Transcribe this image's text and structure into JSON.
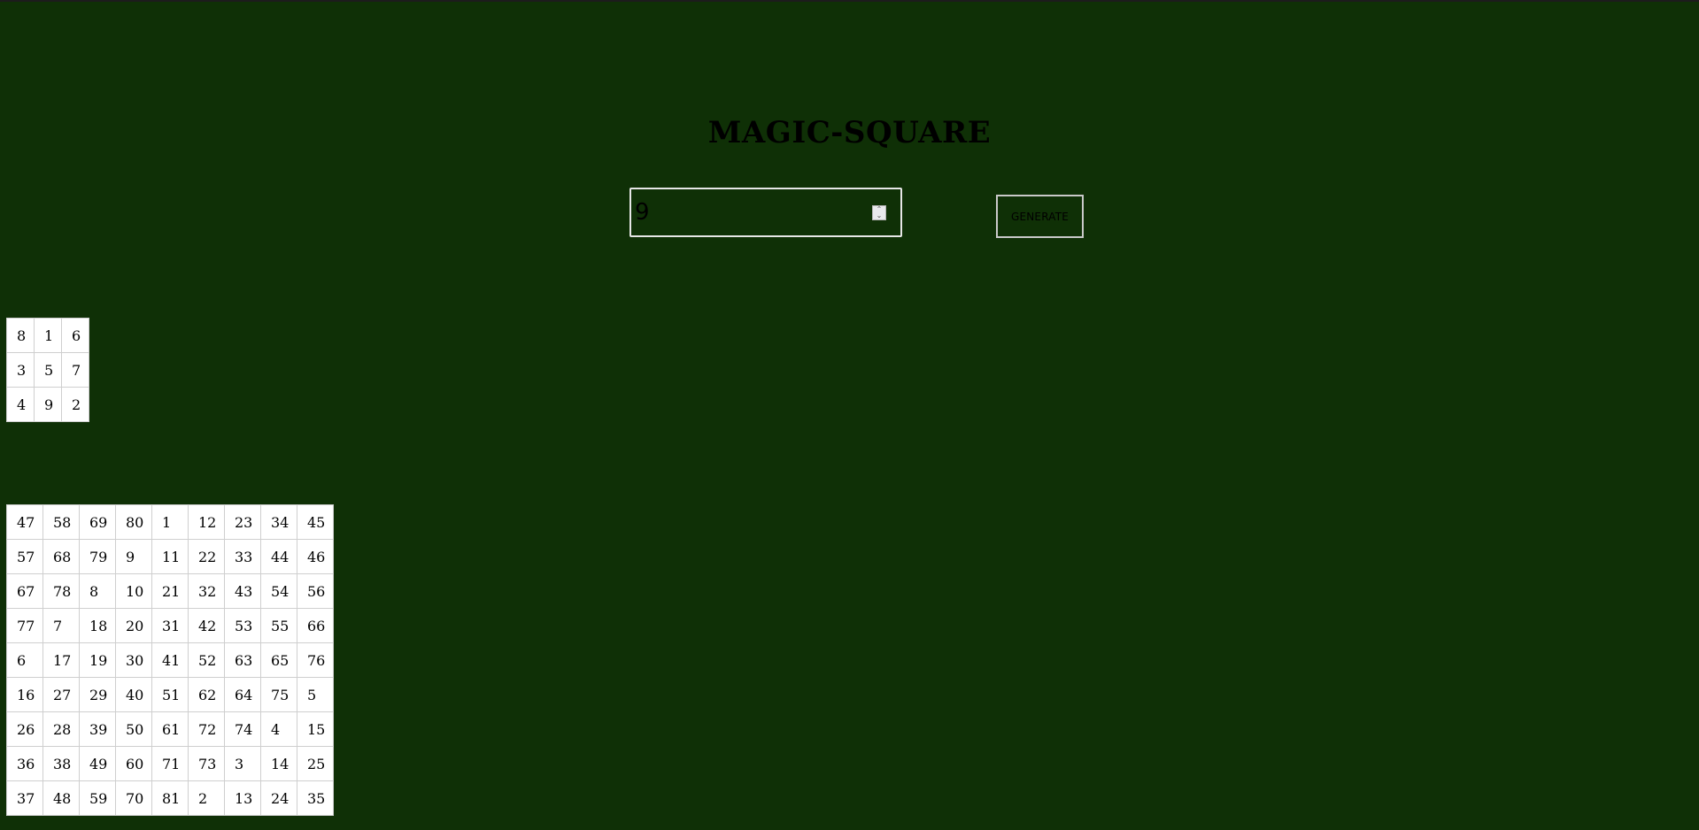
{
  "title": "MAGIC-SQUARE",
  "input": {
    "value": "9"
  },
  "generate_label": "GENERATE",
  "squares": [
    {
      "rows": [
        [
          "8",
          "1",
          "6"
        ],
        [
          "3",
          "5",
          "7"
        ],
        [
          "4",
          "9",
          "2"
        ]
      ]
    },
    {
      "rows": [
        [
          "47",
          "58",
          "69",
          "80",
          "1",
          "12",
          "23",
          "34",
          "45"
        ],
        [
          "57",
          "68",
          "79",
          "9",
          "11",
          "22",
          "33",
          "44",
          "46"
        ],
        [
          "67",
          "78",
          "8",
          "10",
          "21",
          "32",
          "43",
          "54",
          "56"
        ],
        [
          "77",
          "7",
          "18",
          "20",
          "31",
          "42",
          "53",
          "55",
          "66"
        ],
        [
          "6",
          "17",
          "19",
          "30",
          "41",
          "52",
          "63",
          "65",
          "76"
        ],
        [
          "16",
          "27",
          "29",
          "40",
          "51",
          "62",
          "64",
          "75",
          "5"
        ],
        [
          "26",
          "28",
          "39",
          "50",
          "61",
          "72",
          "74",
          "4",
          "15"
        ],
        [
          "36",
          "38",
          "49",
          "60",
          "71",
          "73",
          "3",
          "14",
          "25"
        ],
        [
          "37",
          "48",
          "59",
          "70",
          "81",
          "2",
          "13",
          "24",
          "35"
        ]
      ]
    }
  ]
}
